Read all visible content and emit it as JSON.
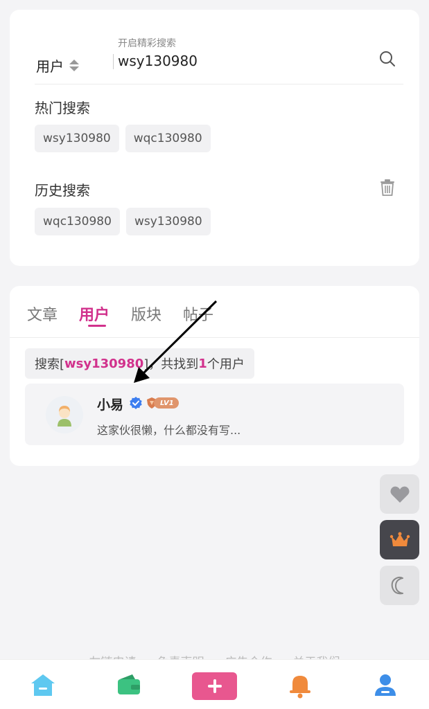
{
  "search": {
    "field_type": "用户",
    "hint": "开启精彩搜索",
    "value": "wsy130980"
  },
  "hot": {
    "title": "热门搜索",
    "items": [
      "wsy130980",
      "wqc130980"
    ]
  },
  "history": {
    "title": "历史搜索",
    "items": [
      "wqc130980",
      "wsy130980"
    ]
  },
  "tabs": [
    "文章",
    "用户",
    "版块",
    "帖子"
  ],
  "active_tab": "用户",
  "result": {
    "prefix": "搜索[",
    "keyword": "wsy130980",
    "mid": "]，共找到",
    "count": "1",
    "suffix": "个用户"
  },
  "user": {
    "name": "小易",
    "level": "LV1",
    "bio": "这家伙很懒，什么都没有写..."
  },
  "footer_links": [
    "友链申请",
    "免责声明",
    "广告合作",
    "关于我们"
  ],
  "tabbar": [
    "home-icon",
    "wallet-icon",
    "plus-icon",
    "bell-icon",
    "profile-icon"
  ],
  "colors": {
    "accent": "#d1318c",
    "plus": "#e8578f",
    "home": "#5ec8f0",
    "wallet": "#3cc281",
    "bell": "#f08a3c",
    "profile": "#3d8ee8"
  }
}
